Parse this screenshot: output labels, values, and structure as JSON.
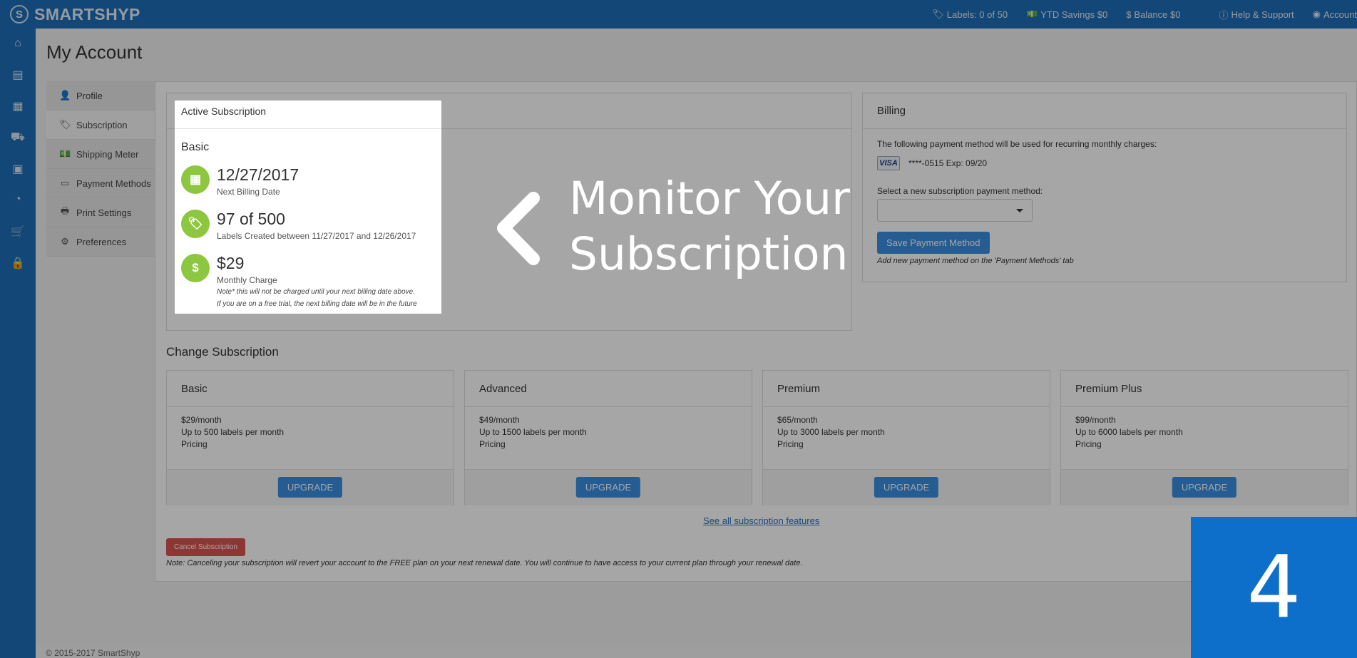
{
  "app": {
    "brand": "SMARTSHYP",
    "logo_letter": "S"
  },
  "topnav": {
    "labels": "Labels: 0 of 50",
    "ytd": "YTD Savings $0",
    "balance": "Balance $0",
    "help": "Help & Support",
    "account": "Account"
  },
  "page": {
    "title": "My Account"
  },
  "settings_nav": [
    {
      "label": "Profile",
      "icon": "user-icon",
      "glyph": "👤"
    },
    {
      "label": "Subscription",
      "icon": "tag-icon",
      "glyph": "🏷"
    },
    {
      "label": "Shipping Meter",
      "icon": "money-icon",
      "glyph": "💵"
    },
    {
      "label": "Payment Methods",
      "icon": "credit-card-icon",
      "glyph": "▭"
    },
    {
      "label": "Print Settings",
      "icon": "printer-icon",
      "glyph": "🖶"
    },
    {
      "label": "Preferences",
      "icon": "gears-icon",
      "glyph": "⚙"
    }
  ],
  "active_subscription": {
    "header": "Active Subscription",
    "plan": "Basic",
    "billing_date": "12/27/2017",
    "billing_date_label": "Next Billing Date",
    "labels_used": "97 of 500",
    "labels_label": "Labels Created between 11/27/2017 and 12/26/2017",
    "charge": "$29",
    "charge_label": "Monthly Charge",
    "note1": "Note* this will not be charged until your next billing date above.",
    "note2": "If you are on a free trial, the next billing date will be in the future"
  },
  "callout": {
    "line1": "Monitor Your",
    "line2": "Subscription"
  },
  "billing": {
    "header": "Billing",
    "intro": "The following payment method will be used for recurring monthly charges:",
    "card_brand": "VISA",
    "card_info": "****-0515 Exp: 09/20",
    "select_label": "Select a new subscription payment method:",
    "select_value": "",
    "save_button": "Save Payment Method",
    "note": "Add new payment method on the 'Payment Methods' tab"
  },
  "change": {
    "title": "Change Subscription",
    "plans": [
      {
        "name": "Basic",
        "price": "$29/month",
        "limit": "Up to 500 labels per month",
        "pricing": "Pricing",
        "button": "UPGRADE"
      },
      {
        "name": "Advanced",
        "price": "$49/month",
        "limit": "Up to 1500 labels per month",
        "pricing": "Pricing",
        "button": "UPGRADE"
      },
      {
        "name": "Premium",
        "price": "$65/month",
        "limit": "Up to 3000 labels per month",
        "pricing": "Pricing",
        "button": "UPGRADE"
      },
      {
        "name": "Premium Plus",
        "price": "$99/month",
        "limit": "Up to 6000 labels per month",
        "pricing": "Pricing",
        "button": "UPGRADE"
      }
    ],
    "features_link": "See all subscription features",
    "cancel_button": "Cancel Subscription",
    "cancel_note": "Note: Canceling your subscription will revert your account to the FREE plan on your next renewal date. You will continue to have access to your current plan through your renewal date."
  },
  "footer": {
    "copyright": "© 2015-2017 SmartShyp"
  },
  "step": {
    "number": "4"
  },
  "colors": {
    "brand_blue": "#1d6eb9",
    "accent_green": "#8dc63f",
    "button_blue": "#3a8ee0",
    "danger_red": "#d9534f",
    "badge_blue": "#0d6fc9"
  }
}
